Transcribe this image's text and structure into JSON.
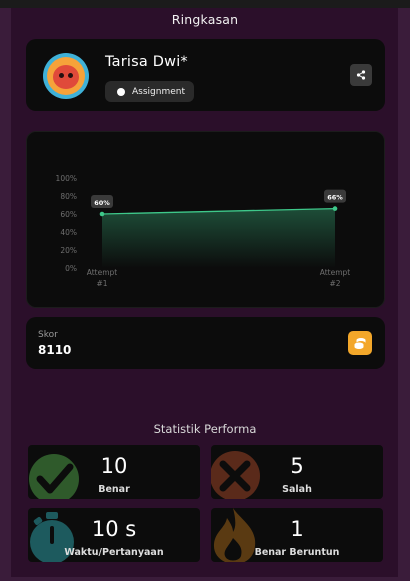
{
  "header": {
    "title": "Ringkasan"
  },
  "profile": {
    "name": "Tarisa Dwi*",
    "badge": "Assignment"
  },
  "chart_data": {
    "type": "line",
    "categories": [
      "Attempt #1",
      "Attempt #2"
    ],
    "category_lines": [
      [
        "Attempt",
        "#1"
      ],
      [
        "Attempt",
        "#2"
      ]
    ],
    "series": [
      {
        "values": [
          60,
          66
        ]
      }
    ],
    "data_labels": [
      "60%",
      "66%"
    ],
    "y_ticks": [
      "100%",
      "80%",
      "60%",
      "40%",
      "20%",
      "0%"
    ],
    "ylim": [
      0,
      100
    ],
    "line_color": "#3ec88a",
    "grid": false
  },
  "score": {
    "label": "Skor",
    "value": "8110"
  },
  "stats": {
    "title": "Statistik Performa",
    "items": [
      {
        "value": "10",
        "label": "Benar",
        "icon": "check-icon"
      },
      {
        "value": "5",
        "label": "Salah",
        "icon": "cross-icon"
      },
      {
        "value": "10 s",
        "label": "Waktu/Pertanyaan",
        "icon": "stopwatch-icon"
      },
      {
        "value": "1",
        "label": "Benar Beruntun",
        "icon": "flame-icon"
      }
    ]
  },
  "colors": {
    "background": "#2b0f2a",
    "card": "#0c0c0c",
    "accent_green": "#3ec88a",
    "coin": "#f3a72a"
  }
}
